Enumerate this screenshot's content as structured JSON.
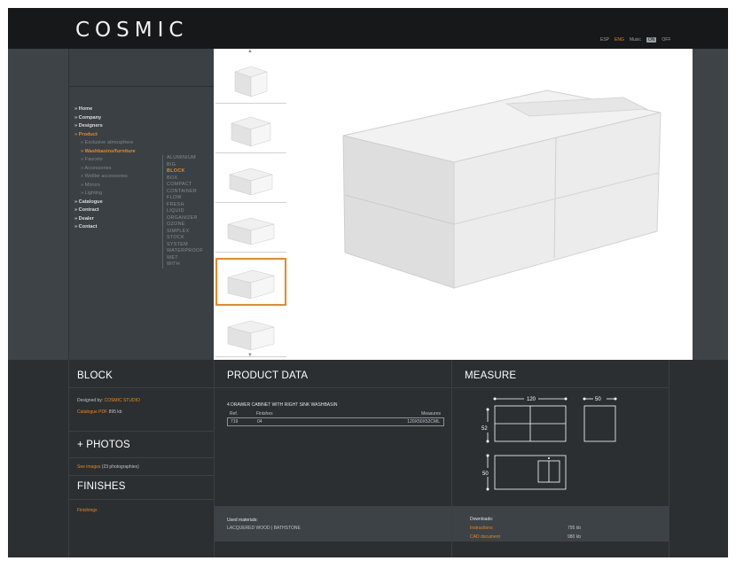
{
  "brand": {
    "logo": "COSMIC"
  },
  "header": {
    "lang_esp": "ESP",
    "lang_eng": "ENG",
    "music_label": "Music",
    "music_on": "ON",
    "music_off": "OFF"
  },
  "nav": {
    "items": [
      {
        "label": "Home"
      },
      {
        "label": "Company"
      },
      {
        "label": "Designers"
      },
      {
        "label": "Product"
      }
    ],
    "sub": [
      {
        "label": "Exclusive atmosphere"
      },
      {
        "label": "Washbasins/furniture"
      },
      {
        "label": "Faucets"
      },
      {
        "label": "Accessories"
      },
      {
        "label": "Wellbe accessories"
      },
      {
        "label": "Mirrors"
      },
      {
        "label": "Lighting"
      }
    ],
    "items2": [
      {
        "label": "Catalogue"
      },
      {
        "label": "Contract"
      },
      {
        "label": "Dealer"
      },
      {
        "label": "Contact"
      }
    ],
    "models": [
      "ALUMINIUM",
      "BIG",
      "BLOCK",
      "BOX",
      "COMPACT",
      "CONTAINER",
      "FLOW",
      "FRESH",
      "LIQUID",
      "ORGANIZER",
      "OZONE",
      "SIMPLEX",
      "STOCK",
      "SYSTEM",
      "WATERPROOF",
      "WET",
      "WITH"
    ],
    "active_model": "BLOCK"
  },
  "block": {
    "title": "BLOCK",
    "designed_by_label": "Designed by:",
    "designed_by_value": "COSMIC STUDIO",
    "catalogue_label": "Catalogue PDF",
    "catalogue_size": "895 kb",
    "photos_title": "+ PHOTOS",
    "see_images": "See images",
    "photo_count": "(23 photographies)",
    "finishes_title": "FINISHES",
    "finishings_link": "Finishings"
  },
  "product": {
    "title": "PRODUCT DATA",
    "description": "4 DRAWER CABINET WITH RIGHT SINK WASHBASIN",
    "headers": [
      "Ref.",
      "Finishes",
      "Measures"
    ],
    "row": [
      "719",
      "04",
      "120X50X52CML"
    ],
    "materials_label": "Used materials:",
    "materials_value": "LACQUERED WOOD | BATHSTONE"
  },
  "measure": {
    "title": "MEASURE",
    "width": "120",
    "depth": "50",
    "height": "52",
    "height2": "50",
    "downloads_label": "Downloads:",
    "instructions": "Instructions",
    "instructions_size": "795 kb",
    "cad": "CAD document",
    "cad_size": "980 kb"
  },
  "colors": {
    "accent": "#e8891f",
    "bg": "#3d4347",
    "topbar": "#161819"
  },
  "icons": [
    "arrow-up-icon",
    "arrow-down-icon",
    "nav-arrow-icon"
  ]
}
